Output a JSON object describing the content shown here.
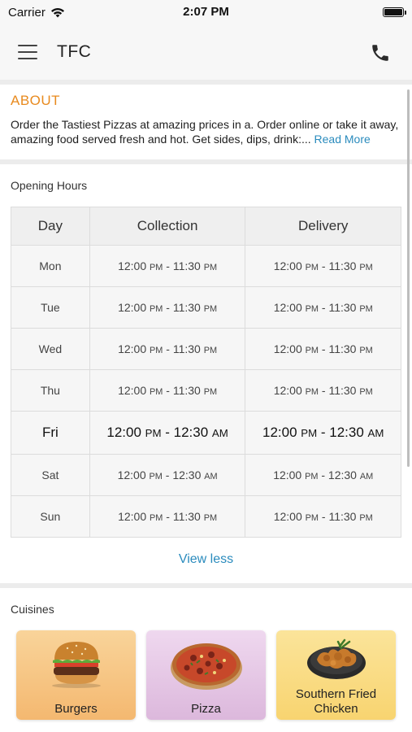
{
  "status_bar": {
    "carrier": "Carrier",
    "time": "2:07 PM",
    "wifi_icon": "wifi-icon",
    "battery_icon": "battery-icon"
  },
  "nav": {
    "title": "TFC",
    "menu_icon": "hamburger-menu-icon",
    "phone_icon": "phone-icon"
  },
  "about": {
    "title": "ABOUT",
    "text": "Order the Tastiest Pizzas at amazing prices in a. Order online or take it away, amazing food served fresh and hot. Get sides, dips, drink:...",
    "read_more": "Read More"
  },
  "opening_hours": {
    "label": "Opening Hours",
    "headers": {
      "day": "Day",
      "collection": "Collection",
      "delivery": "Delivery"
    },
    "rows": [
      {
        "day": "Mon",
        "collection": "12:00 PM - 11:30 PM",
        "delivery": "12:00 PM - 11:30 PM",
        "today": false
      },
      {
        "day": "Tue",
        "collection": "12:00 PM - 11:30 PM",
        "delivery": "12:00 PM - 11:30 PM",
        "today": false
      },
      {
        "day": "Wed",
        "collection": "12:00 PM - 11:30 PM",
        "delivery": "12:00 PM - 11:30 PM",
        "today": false
      },
      {
        "day": "Thu",
        "collection": "12:00 PM - 11:30 PM",
        "delivery": "12:00 PM - 11:30 PM",
        "today": false
      },
      {
        "day": "Fri",
        "collection": "12:00 PM - 12:30 AM",
        "delivery": "12:00 PM - 12:30 AM",
        "today": true
      },
      {
        "day": "Sat",
        "collection": "12:00 PM - 12:30 AM",
        "delivery": "12:00 PM - 12:30 AM",
        "today": false
      },
      {
        "day": "Sun",
        "collection": "12:00 PM - 11:30 PM",
        "delivery": "12:00 PM - 11:30 PM",
        "today": false
      }
    ],
    "view_less": "View less"
  },
  "cuisines": {
    "label": "Cuisines",
    "items": [
      {
        "name": "Burgers",
        "icon": "burger-icon"
      },
      {
        "name": "Pizza",
        "icon": "pizza-icon"
      },
      {
        "name": "Southern Fried Chicken",
        "icon": "fried-chicken-icon"
      }
    ]
  },
  "colors": {
    "accent_orange": "#e88a1e",
    "link_blue": "#2a8bbd"
  }
}
